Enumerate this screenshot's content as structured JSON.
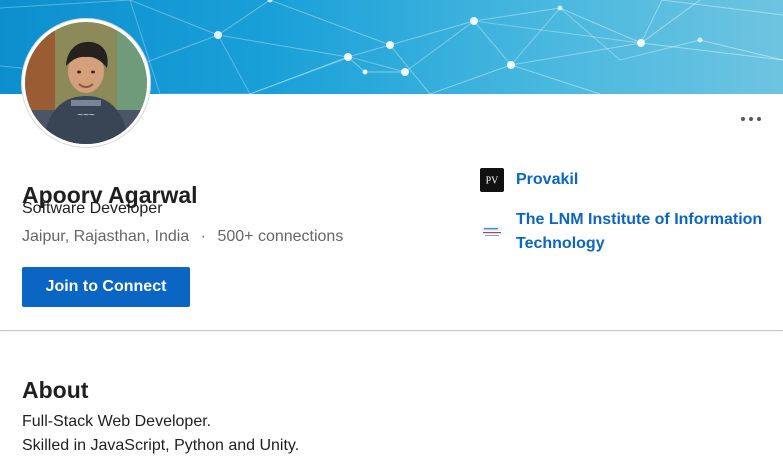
{
  "profile": {
    "name": "Apoorv Agarwal",
    "headline": "Software Developer",
    "location": "Jaipur, Rajasthan, India",
    "separator": "·",
    "connections": "500+ connections",
    "connect_label": "Join to Connect"
  },
  "organizations": [
    {
      "name": "Provakil",
      "logo_text": "PV",
      "logo_color": "#111111"
    },
    {
      "name": "The LNM Institute of Information Technology",
      "logo_text": "",
      "logo_color": "#ffffff"
    }
  ],
  "about": {
    "title": "About",
    "lines": [
      "Full-Stack Web Developer.",
      "Skilled in JavaScript, Python and Unity."
    ]
  },
  "colors": {
    "accent": "#0a66c2",
    "banner_primary": "#0d8fce",
    "banner_secondary": "#6ec4e0"
  },
  "icons": {
    "more": "more-horizontal-icon",
    "avatar": "profile-avatar-icon"
  }
}
